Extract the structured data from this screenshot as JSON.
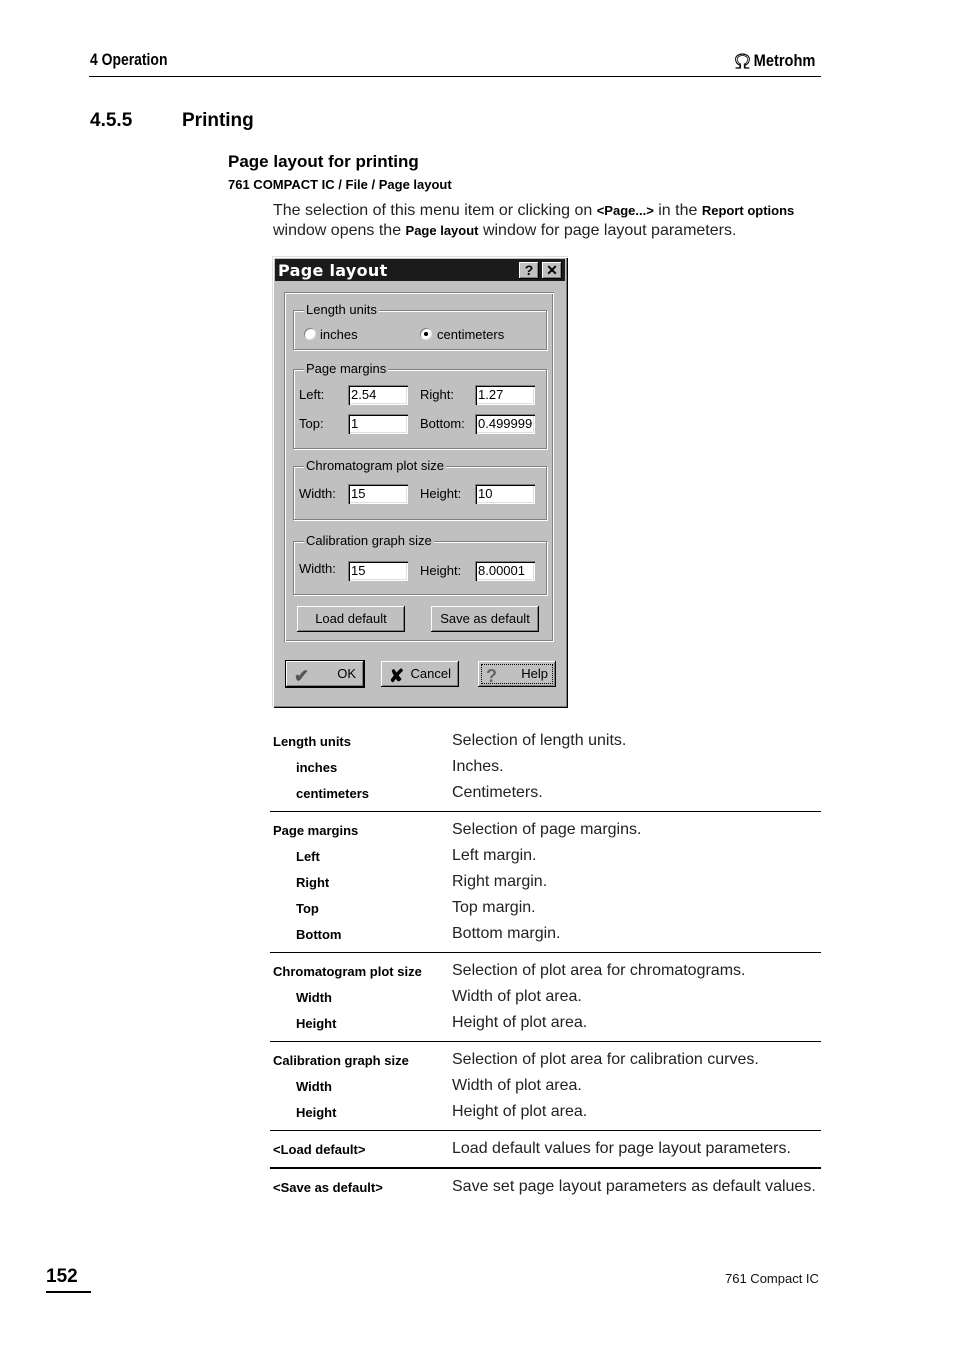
{
  "header": {
    "chapter": "4 Operation",
    "brand": "Metrohm",
    "brand_icon": "omega-logo-icon"
  },
  "section": {
    "number": "4.5.5",
    "title": "Printing"
  },
  "subsection": {
    "title": "Page layout for printing",
    "menu_path": "761 COMPACT IC / File / Page layout"
  },
  "intro": {
    "part1": "The selection of this menu item or clicking on ",
    "bold1": "<Page...>",
    "part2": " in the ",
    "bold2": "Report options",
    "part3": " window opens the ",
    "bold3": "Page layout",
    "part4": " window for page layout parameters."
  },
  "dialog": {
    "title": "Page layout",
    "help_icon": "?",
    "close_icon": "✕",
    "length_units": {
      "label": "Length units",
      "options": [
        {
          "label": "inches",
          "selected": false
        },
        {
          "label": "centimeters",
          "selected": true
        }
      ]
    },
    "page_margins": {
      "label": "Page margins",
      "left_label": "Left:",
      "left_value": "2.54",
      "right_label": "Right:",
      "right_value": "1.27",
      "top_label": "Top:",
      "top_value": "1",
      "bottom_label": "Bottom:",
      "bottom_value": "0.499999"
    },
    "chromatogram": {
      "label": "Chromatogram plot size",
      "width_label": "Width:",
      "width_value": "15",
      "height_label": "Height:",
      "height_value": "10"
    },
    "calibration": {
      "label": "Calibration graph size",
      "width_label": "Width:",
      "width_value": "15",
      "height_label": "Height:",
      "height_value": "8.00001"
    },
    "buttons": {
      "load_default": "Load default",
      "save_as_default": "Save as default",
      "ok": "OK",
      "cancel": "Cancel",
      "help": "Help"
    }
  },
  "table": {
    "groups": [
      {
        "rows": [
          {
            "key": "Length units",
            "value": "Selection of length units.",
            "sub": false
          },
          {
            "key": "inches",
            "value": "Inches.",
            "sub": true
          },
          {
            "key": "centimeters",
            "value": "Centimeters.",
            "sub": true
          }
        ]
      },
      {
        "rows": [
          {
            "key": "Page margins",
            "value": "Selection of page margins.",
            "sub": false
          },
          {
            "key": "Left",
            "value": "Left margin.",
            "sub": true
          },
          {
            "key": "Right",
            "value": "Right margin.",
            "sub": true
          },
          {
            "key": "Top",
            "value": "Top margin.",
            "sub": true
          },
          {
            "key": "Bottom",
            "value": "Bottom margin.",
            "sub": true
          }
        ]
      },
      {
        "rows": [
          {
            "key": "Chromatogram plot size",
            "value": "Selection of plot area for chromatograms.",
            "sub": false
          },
          {
            "key": "Width",
            "value": "Width of plot area.",
            "sub": true
          },
          {
            "key": "Height",
            "value": "Height of plot area.",
            "sub": true
          }
        ]
      },
      {
        "rows": [
          {
            "key": "Calibration graph size",
            "value": "Selection of plot area for calibration curves.",
            "sub": false
          },
          {
            "key": "Width",
            "value": "Width of plot area.",
            "sub": true
          },
          {
            "key": "Height",
            "value": "Height of plot area.",
            "sub": true
          }
        ]
      },
      {
        "rows": [
          {
            "key": "<Load default>",
            "value": "Load default values for page layout parameters.",
            "sub": false
          }
        ]
      },
      {
        "rows": [
          {
            "key": "<Save as default>",
            "value": "Save set page layout parameters as default values.",
            "sub": false
          }
        ]
      }
    ]
  },
  "footer": {
    "page_number": "152",
    "product": "761 Compact IC"
  }
}
